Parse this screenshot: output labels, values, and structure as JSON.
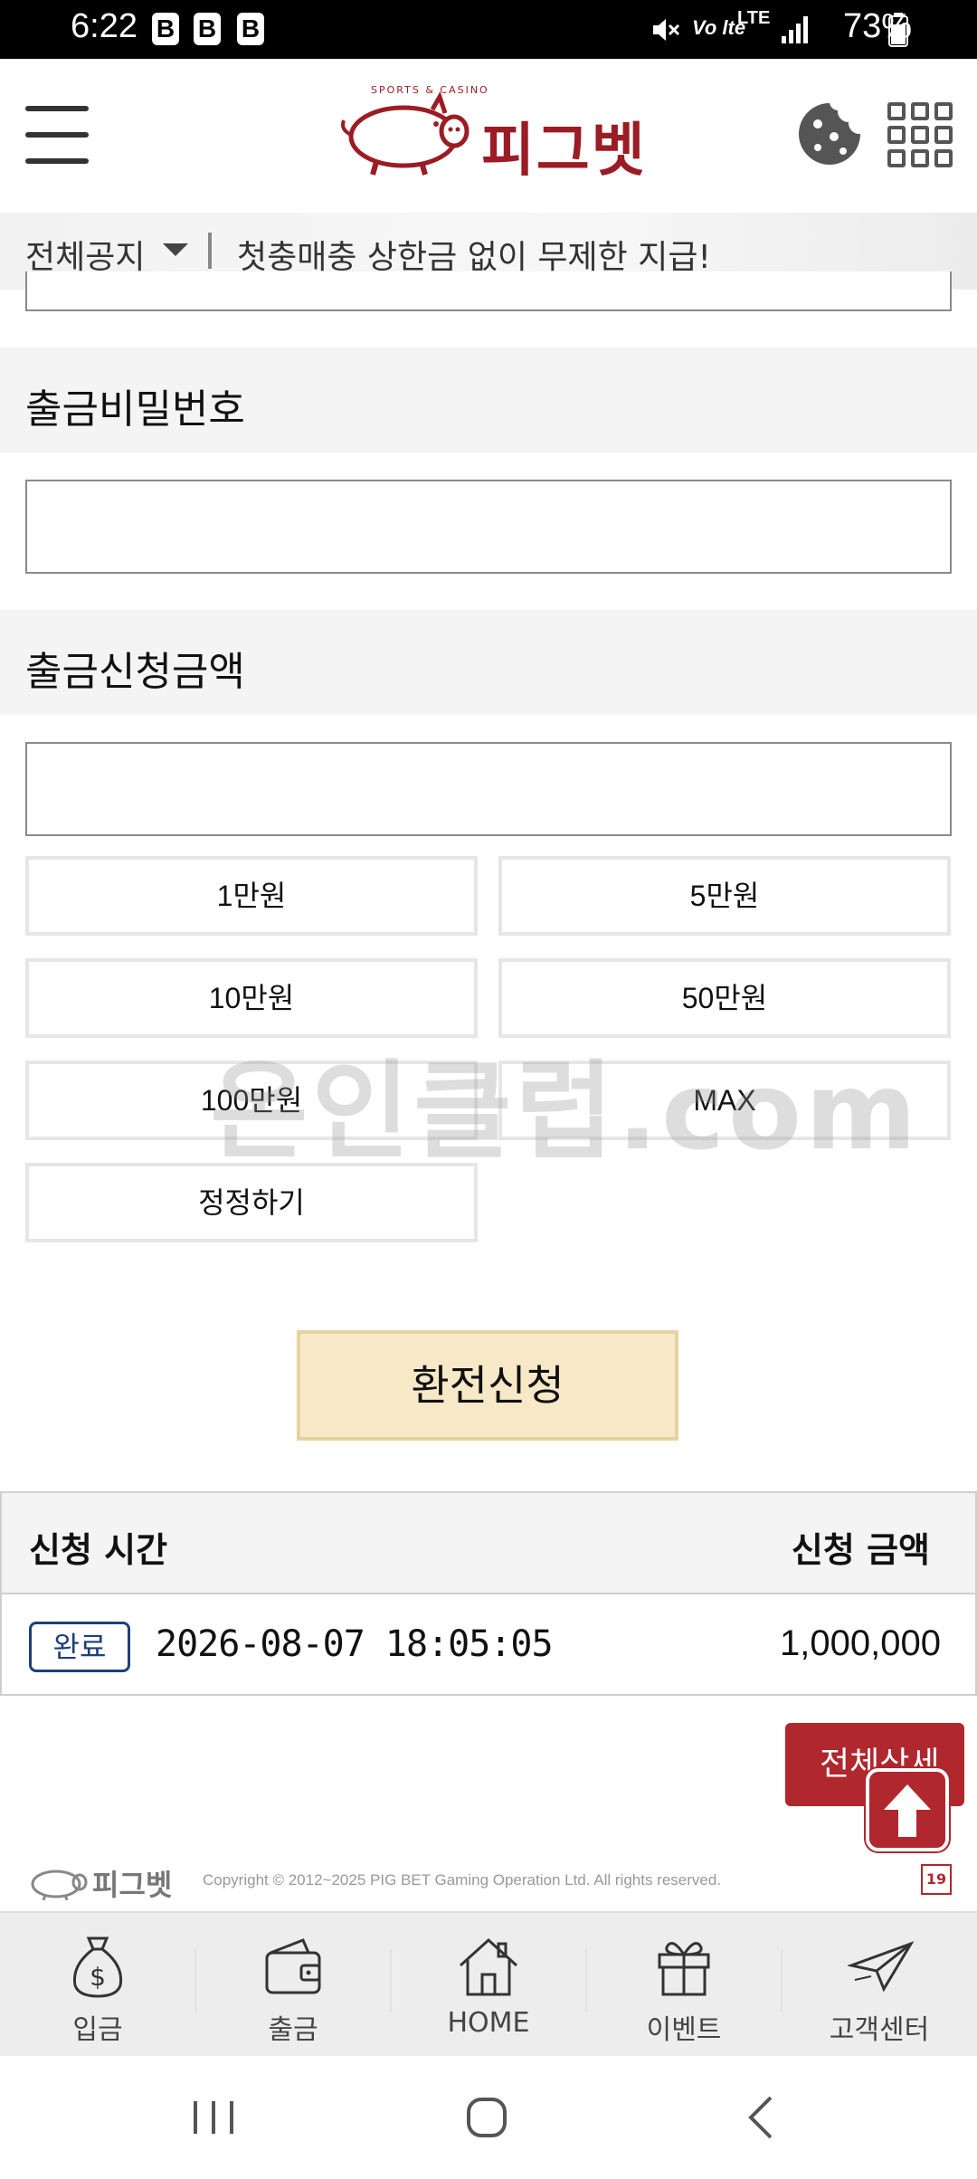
{
  "status_bar": {
    "time": "6:22",
    "notif_b1": "B",
    "notif_b2": "B",
    "notif_b3": "B",
    "volte": "Vo lte",
    "network": "LTE",
    "battery": "73%"
  },
  "header": {
    "logo_text": "피그벳",
    "logo_sub": "SPORTS & CASINO"
  },
  "notice": {
    "label": "전체공지",
    "message": "첫충매충 상한금 없이 무제한 지급!"
  },
  "form": {
    "password_label": "출금비밀번호",
    "password_value": "",
    "amount_label": "출금신청금액",
    "amount_value": "",
    "amount_buttons": [
      "1만원",
      "5만원",
      "10만원",
      "50만원",
      "100만원",
      "MAX"
    ],
    "reset_label": "정정하기",
    "submit_label": "환전신청"
  },
  "history": {
    "col_time": "신청 시간",
    "col_amount": "신청 금액",
    "rows": [
      {
        "status": "완료",
        "time": "2026-08-07 18:05:05",
        "amount": "1,000,000"
      }
    ],
    "detail_button": "전체상세"
  },
  "watermark": "온인클럽.com",
  "footer": {
    "logo_text": "피그벳",
    "copyright": "Copyright © 2012~2025 PIG BET Gaming Operation Ltd. All rights reserved.",
    "age_badge": "19"
  },
  "bottom_nav": [
    {
      "label": "입금",
      "icon": "money-bag-icon"
    },
    {
      "label": "출금",
      "icon": "wallet-icon"
    },
    {
      "label": "HOME",
      "icon": "house-icon"
    },
    {
      "label": "이벤트",
      "icon": "gift-icon"
    },
    {
      "label": "고객센터",
      "icon": "paper-plane-icon"
    }
  ],
  "colors": {
    "brand_red": "#b0272d",
    "submit_bg": "#f7e9c8",
    "badge_blue": "#1f3f78"
  }
}
